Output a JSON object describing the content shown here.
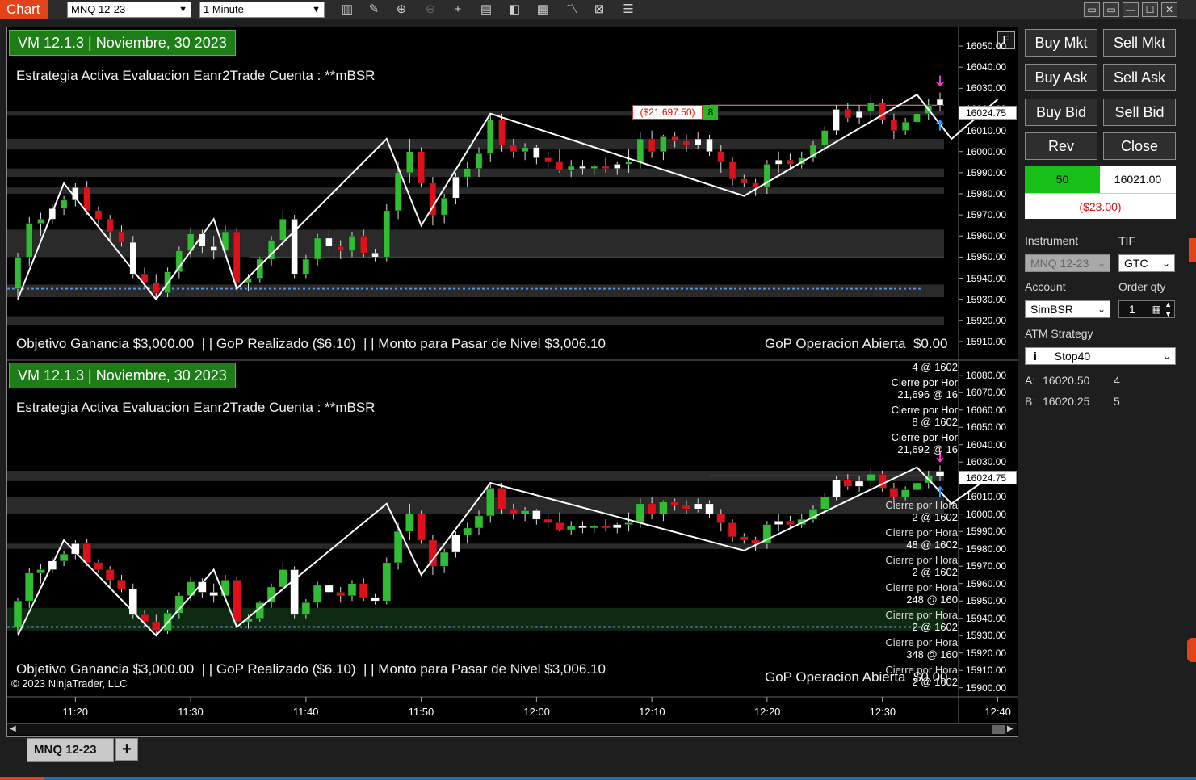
{
  "toolbar": {
    "title": "Chart",
    "instrument": "MNQ 12-23",
    "interval": "1 Minute",
    "icons": [
      "bar-type-icon",
      "pencil-icon",
      "zoom-in-icon",
      "zoom-out-icon",
      "crosshair-icon",
      "data-box-icon",
      "properties-icon",
      "templates-icon",
      "indicators-icon",
      "strategies-icon",
      "chart-trader-icon"
    ]
  },
  "panel1": {
    "header": "VM 12.1.3 | Noviembre, 30  2023",
    "strategy": "Estrategia Activa Evaluacion Eanr2Trade Cuenta : **mBSR",
    "footer_left": "Objetivo Ganancia $3,000.00  | | GoP Realizado ($6.10)  | | Monto para Pasar de Nivel $3,006.10",
    "footer_right": "GoP Operacion Abierta  $0.00",
    "pnl_tag": "($21,697.50)",
    "pnl_qty": "8",
    "axis_button": "F",
    "price_labels": [
      "16050.00",
      "16040.00",
      "16030.00",
      "16020.00",
      "16010.00",
      "16000.00",
      "15990.00",
      "15980.00",
      "15970.00",
      "15960.00",
      "15950.00",
      "15940.00",
      "15930.00",
      "15920.00",
      "15910.00"
    ],
    "last_price": "16024.75"
  },
  "panel2": {
    "header": "VM 12.1.3 | Noviembre, 30  2023",
    "strategy": "Estrategia Activa Evaluacion Eanr2Trade Cuenta : **mBSR",
    "footer_left": "Objetivo Ganancia $3,000.00  | | GoP Realizado ($6.10)  | | Monto para Pasar de Nivel $3,006.10",
    "footer_right": "GoP Operacion Abierta  $0.00",
    "copyright": "© 2023 NinjaTrader, LLC",
    "price_labels": [
      "16080.00",
      "16070.00",
      "16060.00",
      "16050.00",
      "16040.00",
      "16030.00",
      "16020.00",
      "16010.00",
      "16000.00",
      "15990.00",
      "15980.00",
      "15970.00",
      "15960.00",
      "15950.00",
      "15940.00",
      "15930.00",
      "15920.00",
      "15910.00",
      "15900.00"
    ],
    "last_price": "16024.75",
    "exec_labels": [
      "4 @ 1602",
      "Cierre por Hor",
      "21,696 @ 16",
      "Cierre por Hor",
      "8 @ 1602",
      "Cierre por Hor",
      "21,692 @ 16",
      "Cierre por Hora",
      "2 @ 1602",
      "Cierre por Hora",
      "48 @ 1602",
      "Cierre por Hora",
      "2 @ 1602",
      "Cierre por Hora",
      "248 @ 160",
      "Cierre por Hora",
      "2 @ 1602",
      "Cierre por Hora",
      "348 @ 160",
      "Cierre por Hora",
      "2 @ 1602"
    ]
  },
  "time_axis": [
    "11:20",
    "11:30",
    "11:40",
    "11:50",
    "12:00",
    "12:10",
    "12:20",
    "12:30",
    "12:40"
  ],
  "chart_trader": {
    "buy_mkt": "Buy Mkt",
    "sell_mkt": "Sell Mkt",
    "buy_ask": "Buy Ask",
    "sell_ask": "Sell Ask",
    "buy_bid": "Buy Bid",
    "sell_bid": "Sell Bid",
    "rev": "Rev",
    "close": "Close",
    "position_qty": "50",
    "position_price": "16021.00",
    "position_pnl": "($23.00)",
    "instrument_label": "Instrument",
    "instrument_value": "MNQ 12-23",
    "tif_label": "TIF",
    "tif_value": "GTC",
    "account_label": "Account",
    "account_value": "SimBSR",
    "qty_label": "Order qty",
    "qty_value": "1",
    "atm_label": "ATM Strategy",
    "atm_value": "Stop40",
    "ask_label": "A:",
    "ask_price": "16020.50",
    "ask_size": "4",
    "bid_label": "B:",
    "bid_price": "16020.25",
    "bid_size": "5"
  },
  "bottom_tabs": {
    "active": "MNQ 12-23",
    "add": "+"
  },
  "colors": {
    "up_candle": "#2fbd32",
    "down_candle": "#e0101a",
    "header_bg": "#1d7d16",
    "zigzag": "#ffffff",
    "accent": "#e4431a"
  },
  "chart_data": {
    "type": "candlestick",
    "x": [
      "11:15",
      "11:16",
      "11:17",
      "11:18",
      "11:19",
      "11:20",
      "11:21",
      "11:22",
      "11:23",
      "11:24",
      "11:25",
      "11:26",
      "11:27",
      "11:28",
      "11:29",
      "11:30",
      "11:31",
      "11:32",
      "11:33",
      "11:34",
      "11:35",
      "11:36",
      "11:37",
      "11:38",
      "11:39",
      "11:40",
      "11:41",
      "11:42",
      "11:43",
      "11:44",
      "11:45",
      "11:46",
      "11:47",
      "11:48",
      "11:49",
      "11:50",
      "11:51",
      "11:52",
      "11:53",
      "11:54",
      "11:55",
      "11:56",
      "11:57",
      "11:58",
      "11:59",
      "12:00",
      "12:01",
      "12:02",
      "12:03",
      "12:04",
      "12:05",
      "12:06",
      "12:07",
      "12:08",
      "12:09",
      "12:10",
      "12:11",
      "12:12",
      "12:13",
      "12:14",
      "12:15",
      "12:16",
      "12:17",
      "12:18",
      "12:19",
      "12:20",
      "12:21",
      "12:22",
      "12:23",
      "12:24",
      "12:25",
      "12:26",
      "12:27",
      "12:28",
      "12:29",
      "12:30",
      "12:31",
      "12:32",
      "12:33",
      "12:34",
      "12:35",
      "12:36",
      "12:37",
      "12:38",
      "12:39",
      "12:40"
    ],
    "ohlc": [
      [
        15935,
        15952,
        15931,
        15950
      ],
      [
        15950,
        15969,
        15946,
        15966
      ],
      [
        15966,
        15971,
        15960,
        15968
      ],
      [
        15968,
        15975,
        15966,
        15973
      ],
      [
        15973,
        15979,
        15970,
        15977
      ],
      [
        15977,
        15985,
        15974,
        15983
      ],
      [
        15983,
        15986,
        15970,
        15972
      ],
      [
        15972,
        15974,
        15966,
        15968
      ],
      [
        15968,
        15970,
        15958,
        15962
      ],
      [
        15962,
        15965,
        15955,
        15957
      ],
      [
        15957,
        15960,
        15940,
        15942
      ],
      [
        15942,
        15945,
        15935,
        15938
      ],
      [
        15938,
        15942,
        15930,
        15933
      ],
      [
        15933,
        15945,
        15931,
        15943
      ],
      [
        15943,
        15955,
        15940,
        15953
      ],
      [
        15953,
        15964,
        15950,
        15961
      ],
      [
        15961,
        15963,
        15952,
        15955
      ],
      [
        15955,
        15960,
        15949,
        15953
      ],
      [
        15953,
        15965,
        15950,
        15962
      ],
      [
        15962,
        15964,
        15935,
        15938
      ],
      [
        15938,
        15942,
        15934,
        15940
      ],
      [
        15940,
        15950,
        15938,
        15949
      ],
      [
        15949,
        15960,
        15946,
        15958
      ],
      [
        15958,
        15972,
        15955,
        15968
      ],
      [
        15968,
        15970,
        15940,
        15942
      ],
      [
        15942,
        15951,
        15940,
        15949
      ],
      [
        15949,
        15961,
        15946,
        15959
      ],
      [
        15959,
        15963,
        15952,
        15955
      ],
      [
        15955,
        15958,
        15949,
        15953
      ],
      [
        15953,
        15962,
        15950,
        15960
      ],
      [
        15960,
        15963,
        15950,
        15952
      ],
      [
        15952,
        15954,
        15948,
        15950
      ],
      [
        15950,
        15975,
        15948,
        15972
      ],
      [
        15972,
        15995,
        15968,
        15990
      ],
      [
        15990,
        16006,
        15985,
        16000
      ],
      [
        16000,
        16002,
        15983,
        15985
      ],
      [
        15985,
        15988,
        15965,
        15970
      ],
      [
        15970,
        15980,
        15966,
        15978
      ],
      [
        15978,
        15990,
        15975,
        15988
      ],
      [
        15988,
        15995,
        15983,
        15992
      ],
      [
        15992,
        16002,
        15988,
        15999
      ],
      [
        15999,
        16018,
        15995,
        16015
      ],
      [
        16015,
        16018,
        16000,
        16003
      ],
      [
        16003,
        16006,
        15997,
        16000
      ],
      [
        16000,
        16004,
        15996,
        16002
      ],
      [
        16002,
        16003,
        15994,
        15997
      ],
      [
        15997,
        16000,
        15992,
        15995
      ],
      [
        15995,
        16001,
        15990,
        15991
      ],
      [
        15991,
        15996,
        15988,
        15993
      ],
      [
        15993,
        15996,
        15989,
        15992
      ],
      [
        15992,
        15994,
        15989,
        15993
      ],
      [
        15993,
        15997,
        15990,
        15992
      ],
      [
        15992,
        15995,
        15989,
        15994
      ],
      [
        15994,
        16001,
        15990,
        15995
      ],
      [
        15995,
        16009,
        15992,
        16006
      ],
      [
        16006,
        16010,
        15997,
        16000
      ],
      [
        16000,
        16008,
        15996,
        16007
      ],
      [
        16007,
        16009,
        16002,
        16005
      ],
      [
        16005,
        16008,
        16000,
        16003
      ],
      [
        16003,
        16009,
        16001,
        16006
      ],
      [
        16006,
        16008,
        15998,
        16000
      ],
      [
        16000,
        16003,
        15990,
        15995
      ],
      [
        15995,
        15997,
        15984,
        15987
      ],
      [
        15987,
        15989,
        15983,
        15985
      ],
      [
        15985,
        15987,
        15979,
        15983
      ],
      [
        15983,
        15996,
        15980,
        15994
      ],
      [
        15994,
        16000,
        15990,
        15996
      ],
      [
        15996,
        15999,
        15992,
        15994
      ],
      [
        15994,
        16000,
        15992,
        15997
      ],
      [
        15997,
        16005,
        15995,
        16003
      ],
      [
        16003,
        16012,
        16000,
        16010
      ],
      [
        16010,
        16022,
        16008,
        16020
      ],
      [
        16020,
        16023,
        16014,
        16016
      ],
      [
        16016,
        16022,
        16013,
        16019
      ],
      [
        16019,
        16027,
        16015,
        16023
      ],
      [
        16023,
        16025,
        16013,
        16015
      ],
      [
        16015,
        16018,
        16006,
        16010
      ],
      [
        16010,
        16016,
        16008,
        16014
      ],
      [
        16014,
        16019,
        16010,
        16018
      ],
      [
        16018,
        16025,
        16015,
        16022
      ],
      [
        16022,
        16028,
        16019,
        16024.75
      ]
    ],
    "zigzag": [
      [
        "11:15",
        15930
      ],
      [
        "11:19",
        15985
      ],
      [
        "11:27",
        15930
      ],
      [
        "11:32",
        15968
      ],
      [
        "11:34",
        15935
      ],
      [
        "11:47",
        16006
      ],
      [
        "11:50",
        15965
      ],
      [
        "11:56",
        16018
      ],
      [
        "12:18",
        15979
      ],
      [
        "12:33",
        16027
      ],
      [
        "12:36",
        16006
      ],
      [
        "12:40",
        16024.75
      ]
    ],
    "ylim_top": [
      15905,
      16055
    ],
    "ylim_bottom": [
      15898,
      16085
    ],
    "last_price": 16024.75
  }
}
